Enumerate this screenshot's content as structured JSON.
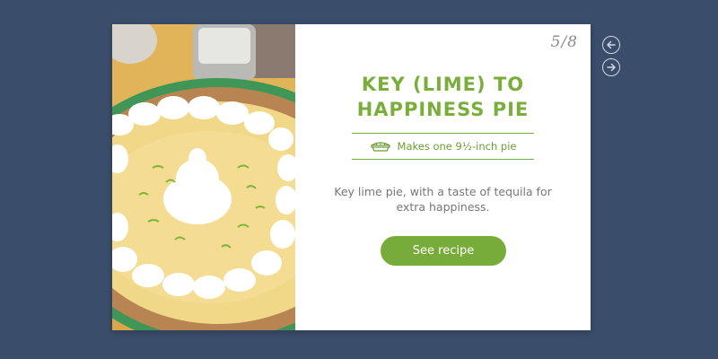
{
  "slide": {
    "counter": "5/8"
  },
  "recipe": {
    "title_line1": "KEY (LIME) TO",
    "title_line2": "HAPPINESS PIE",
    "yield": "Makes one 9½-inch pie",
    "description": "Key lime pie, with a taste of tequila for extra happiness.",
    "cta_label": "See recipe"
  },
  "icons": {
    "yield": "pie-icon",
    "prev": "arrow-left-circle-icon",
    "next": "arrow-right-circle-icon"
  },
  "colors": {
    "background": "#3a4d6b",
    "accent_green": "#7aae3b",
    "button_green": "#78ac3a",
    "text_gray": "#777777"
  }
}
